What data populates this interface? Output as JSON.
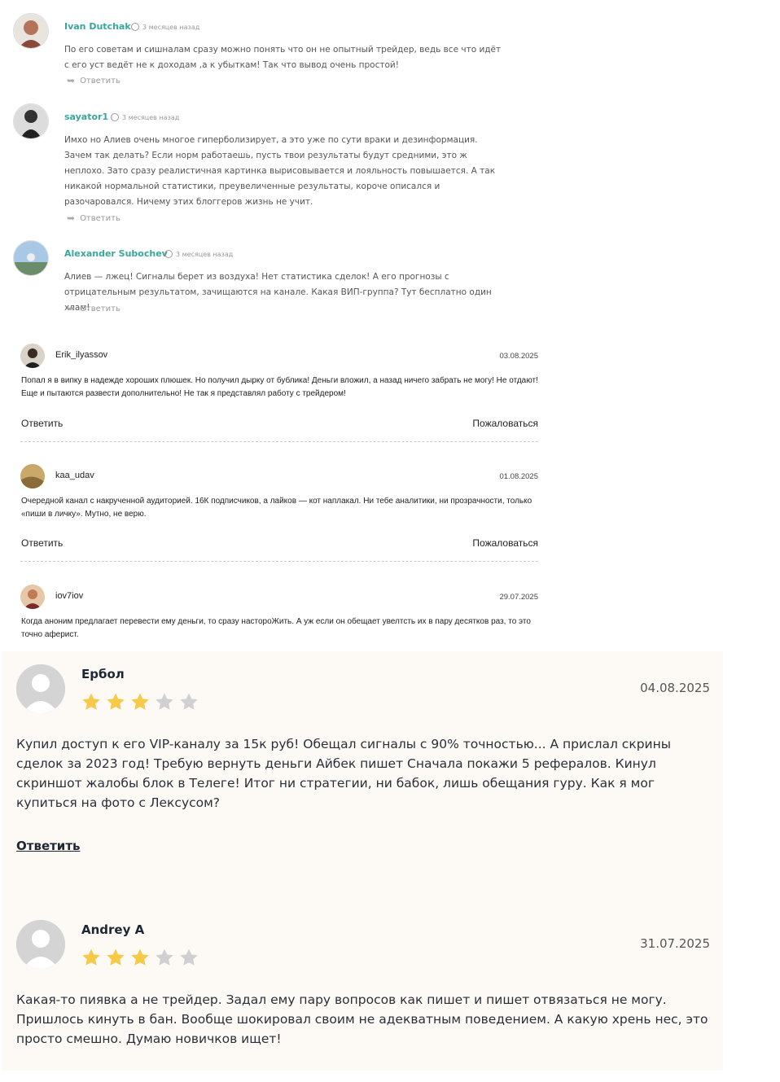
{
  "section_a": {
    "reply_label": "Ответить",
    "comments": [
      {
        "name": "Ivan Dutchak",
        "date": "3 месяцев назад",
        "text": "По его советам и сишналам сразу можно понять что он не опытный трейдер, ведь все что идёт с его уст ведёт не к доходам ,а к убыткам! Так что вывод очень простой!"
      },
      {
        "name": "sayator1",
        "date": "3 месяцев назад",
        "text": "Имхо но Алиев очень многое гиперболизирует, а это уже по сути враки и дезинформация. Зачем так делать? Если норм работаешь, пусть твои результаты будут средними, это ж неплохо. Зато сразу реалистичная картинка вырисовывается и лояльность повышается. А так никакой нормальной статистики, преувеличенные результаты, короче описался и разочаровался. Ничему этих блоггеров жизнь не учит."
      },
      {
        "name": "Alexander Subochev",
        "date": "3 месяцев назад",
        "text": "Алиев — лжец! Сигналы берет из воздуха! Нет статистика сделок! А его прогнозы с отрицательным результатом, зачищаются на канале. Какая ВИП-группа? Тут бесплатно один хлам!"
      }
    ]
  },
  "section_b": {
    "reply_label": "Ответить",
    "report_label": "Пожаловаться",
    "comments": [
      {
        "name": "Erik_ilyassov",
        "date": "03.08.2025",
        "text": "Попал я в випку в надежде хороших плюшек. Но получил дырку от бублика! Деньги вложил, а назад ничего забрать не могу! Не отдают! Еще и пытаются развести дополнительно! Не так я представлял работу с трейдером!"
      },
      {
        "name": "kaa_udav",
        "date": "01.08.2025",
        "text": "Очередной канал с накрученной аудиторией. 16К подписчиков, а лайков — кот наплакал. Ни тебе аналитики, ни прозрачности, только «пиши в личку». Мутно, не верю."
      },
      {
        "name": "iov7iov",
        "date": "29.07.2025",
        "text": "Когда аноним предлагает перевести ему деньги, то сразу настороЖить. А уж если он обещает увелтсть их в пару десятков раз, то это точно аферист."
      }
    ]
  },
  "section_c": {
    "reply_label": "Ответить",
    "star_color_on": "#f7c948",
    "star_color_off": "#d0d0d0",
    "reviews": [
      {
        "name": "Ербол",
        "rating": 3,
        "date": "04.08.2025",
        "text": "Купил доступ к его VIP-каналу за 15к руб! Обещал сигналы с 90% точностью... А прислал скрины сделок за 2023 год! Требую вернуть деньги Айбек пишет Сначала покажи 5 рефералов. Кинул скриншот жалобы блок в Телеге! Итог ни стратегии, ни бабок, лишь обещания гуру. Как я мог купиться на фото с Лексусом?"
      },
      {
        "name": "Andrey A",
        "rating": 3,
        "date": "31.07.2025",
        "text": "Какая-то пиявка а не трейдер. Задал ему пару вопросов как пишет и пишет отвязаться не могу. Пришлось кинуть в бан. Вообще шокировал своим не адекватным поведением. А какую хрень нес, это просто смешно. Думаю новичков ищет!"
      }
    ]
  }
}
